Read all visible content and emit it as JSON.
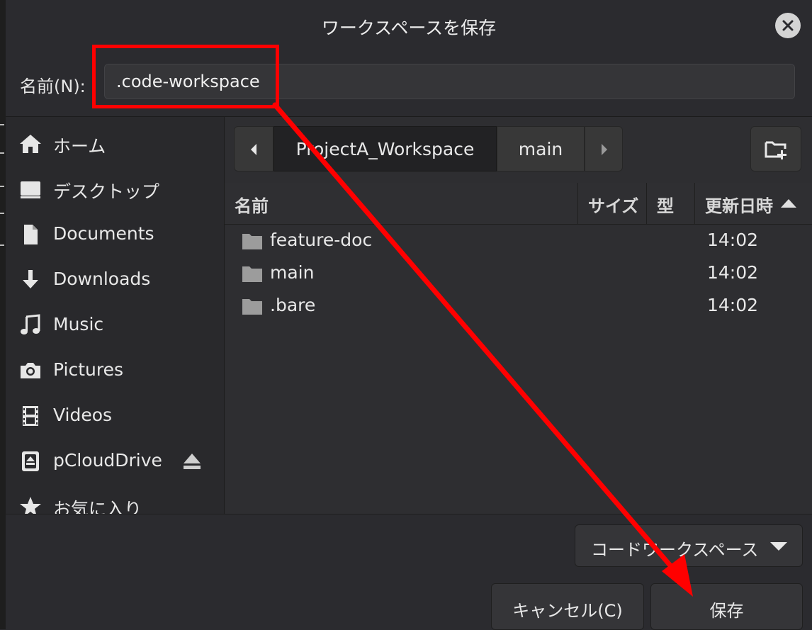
{
  "dialog": {
    "title": "ワークスペースを保存",
    "close_icon": "close-icon"
  },
  "name_row": {
    "label": "名前(N):",
    "value": ".code-workspace"
  },
  "sidebar": {
    "items": [
      {
        "label": "ホーム",
        "icon": "home-icon"
      },
      {
        "label": "デスクトップ",
        "icon": "desktop-icon"
      },
      {
        "label": "Documents",
        "icon": "document-icon"
      },
      {
        "label": "Downloads",
        "icon": "download-icon"
      },
      {
        "label": "Music",
        "icon": "music-icon"
      },
      {
        "label": "Pictures",
        "icon": "camera-icon"
      },
      {
        "label": "Videos",
        "icon": "film-icon"
      },
      {
        "label": "pCloudDrive",
        "icon": "drive-icon"
      },
      {
        "label": "お気に入り",
        "icon": "star-icon"
      }
    ]
  },
  "pathbar": {
    "segments": [
      "ProjectA_Workspace",
      "main"
    ]
  },
  "file_header": {
    "name": "名前",
    "size": "サイズ",
    "type": "型",
    "modified": "更新日時"
  },
  "files": [
    {
      "name": "feature-doc",
      "modified": "14:02"
    },
    {
      "name": "main",
      "modified": "14:02"
    },
    {
      "name": ".bare",
      "modified": "14:02"
    }
  ],
  "filter": {
    "selected": "コードワークスペース"
  },
  "buttons": {
    "cancel": "キャンセル(C)",
    "save": "保存"
  },
  "colors": {
    "annotation": "#ff0000",
    "background": "#2e2e31"
  }
}
